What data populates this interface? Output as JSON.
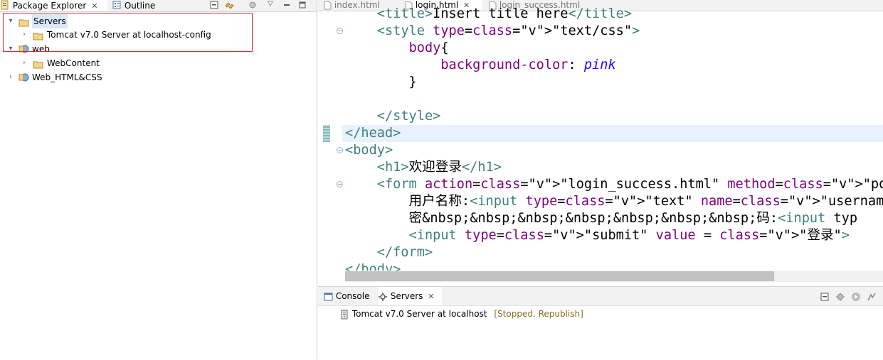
{
  "left_pane": {
    "tabs": [
      {
        "label": "Package Explorer",
        "icon": "package-explorer-icon"
      },
      {
        "label": "Outline",
        "icon": "outline-icon"
      }
    ],
    "tree": [
      {
        "label": "Servers",
        "expanded": true,
        "level": 0,
        "icon": "folder-open-icon",
        "selected": true
      },
      {
        "label": "Tomcat v7.0 Server at localhost-config",
        "expanded": false,
        "level": 1,
        "icon": "folder-open-icon"
      },
      {
        "label": "web",
        "expanded": true,
        "level": 0,
        "icon": "web-project-icon"
      },
      {
        "label": "WebContent",
        "expanded": false,
        "level": 1,
        "icon": "folder-open-icon"
      },
      {
        "label": "Web_HTML&CSS",
        "expanded": false,
        "level": 0,
        "icon": "web-project-icon"
      }
    ]
  },
  "editor": {
    "tabs": [
      {
        "label": "index.html",
        "active": false
      },
      {
        "label": "login.html",
        "active": true
      },
      {
        "label": "login_success.html",
        "active": false
      }
    ],
    "code": [
      "    <title>Insert title here</title>",
      "    <style type=\"text/css\">",
      "        body{",
      "            background-color: pink",
      "        }",
      "",
      "    </style>",
      "</head>",
      "<body>",
      "    <h1>欢迎登录</h1>",
      "    <form action=\"login_success.html\" method=\"post\">",
      "        用户名称:<input type=\"text\" name=\"username\"><br>",
      "        密&nbsp;&nbsp;&nbsp;&nbsp;&nbsp;&nbsp;&nbsp;码:<input typ",
      "        <input type=\"submit\" value = \"登录\">",
      "    </form>",
      "</body>"
    ]
  },
  "bottom_panel": {
    "tabs": [
      {
        "label": "Console",
        "icon": "console-icon"
      },
      {
        "label": "Servers",
        "icon": "servers-icon"
      }
    ],
    "server_name": "Tomcat v7.0 Server at localhost",
    "server_status": "[Stopped, Republish]"
  },
  "colors": {
    "tag": "#3f7f7f",
    "attr": "#7f007f",
    "value": "#2a00ff",
    "highlight_border": "#e0262f",
    "selection": "#d9e8fb"
  }
}
